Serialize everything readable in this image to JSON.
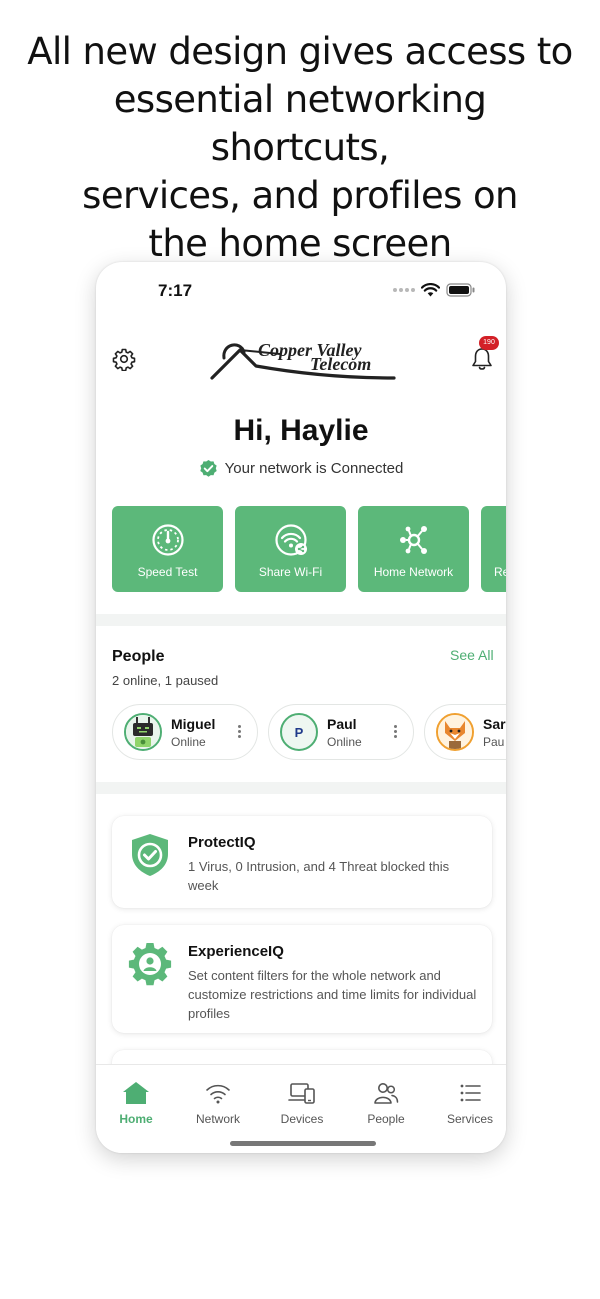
{
  "headline": {
    "line1": "All new design gives access to",
    "line2": "essential networking shortcuts,",
    "line3": "services, and profiles on",
    "line4": "the home screen"
  },
  "status_bar": {
    "time": "7:17"
  },
  "header": {
    "logo_line1": "Copper Valley",
    "logo_line2": "Telecom",
    "notification_count": "190",
    "settings_icon": "gear-icon",
    "notifications_icon": "bell-icon"
  },
  "greeting": "Hi, Haylie",
  "network_status": "Your network is Connected",
  "shortcuts": [
    {
      "label": "Speed Test",
      "icon": "speedometer-icon"
    },
    {
      "label": "Share Wi-Fi",
      "icon": "wifi-share-icon"
    },
    {
      "label": "Home Network",
      "icon": "network-hub-icon"
    },
    {
      "label": "Re",
      "icon": ""
    }
  ],
  "people": {
    "title": "People",
    "subtitle": "2 online, 1 paused",
    "see_all": "See All",
    "profiles": [
      {
        "name": "Miguel",
        "status": "Online"
      },
      {
        "name": "Paul",
        "status": "Online",
        "initial": "P"
      },
      {
        "name": "Sar",
        "status": "Pau"
      }
    ]
  },
  "services": [
    {
      "title": "ProtectIQ",
      "description": "1 Virus, 0 Intrusion, and 4 Threat blocked this week",
      "icon": "shield-check-icon"
    },
    {
      "title": "ExperienceIQ",
      "description": "Set content filters for the whole network and customize restrictions and time limits for individual profiles",
      "icon": "gear-person-icon"
    }
  ],
  "bottom_nav": [
    {
      "label": "Home",
      "icon": "home-icon",
      "active": true
    },
    {
      "label": "Network",
      "icon": "wifi-icon",
      "active": false
    },
    {
      "label": "Devices",
      "icon": "devices-icon",
      "active": false
    },
    {
      "label": "People",
      "icon": "people-icon",
      "active": false
    },
    {
      "label": "Services",
      "icon": "list-icon",
      "active": false
    }
  ],
  "colors": {
    "brand_green": "#5cb87a",
    "accent_green": "#4eae73",
    "badge_red": "#d32027"
  }
}
